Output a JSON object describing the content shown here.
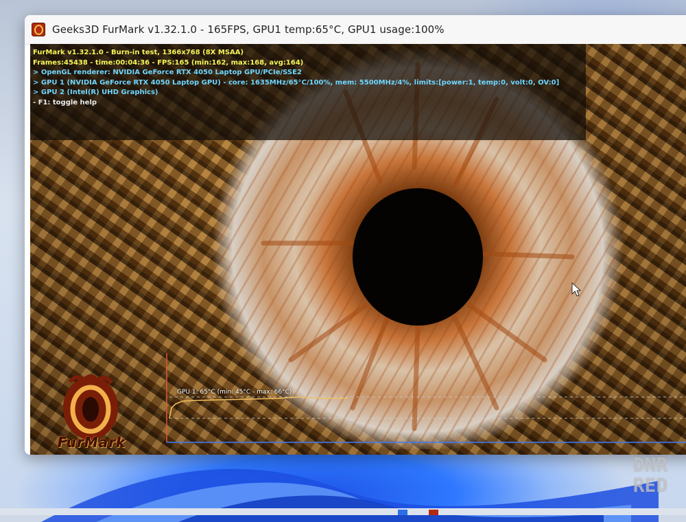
{
  "window": {
    "title": "Geeks3D FurMark v1.32.1.0 - 165FPS, GPU1 temp:65°C, GPU1 usage:100%",
    "icon": "furmark-app-icon"
  },
  "hud": {
    "lines": [
      "FurMark v1.32.1.0 - Burn-in test, 1366x768 (8X MSAA)",
      "Frames:45438 - time:00:04:36 - FPS:165 (min:162, max:168, avg:164)",
      "> OpenGL renderer: NVIDIA GeForce RTX 4050 Laptop GPU/PCIe/SSE2",
      "> GPU 1 (NVIDIA GeForce RTX 4050 Laptop GPU) - core: 1635MHz/65°C/100%, mem: 5500MHz/4%, limits:[power:1, temp:0, volt:0, OV:0]",
      "> GPU 2 (Intel(R) UHD Graphics)",
      "- F1: toggle help"
    ],
    "colors": {
      "title": "#f4f55a",
      "info": "#6fd6ff",
      "help": "#ececec"
    }
  },
  "graph": {
    "label": "GPU 1: 65°C (min: 45°C - max: 66°C)",
    "line_color": "#f0c060",
    "axis_color": "#e05a3a",
    "frame_color": "#3a7cff"
  },
  "logo": {
    "text": "FurMark"
  },
  "watermark": {
    "line1": "DNR",
    "line2": "RED"
  }
}
